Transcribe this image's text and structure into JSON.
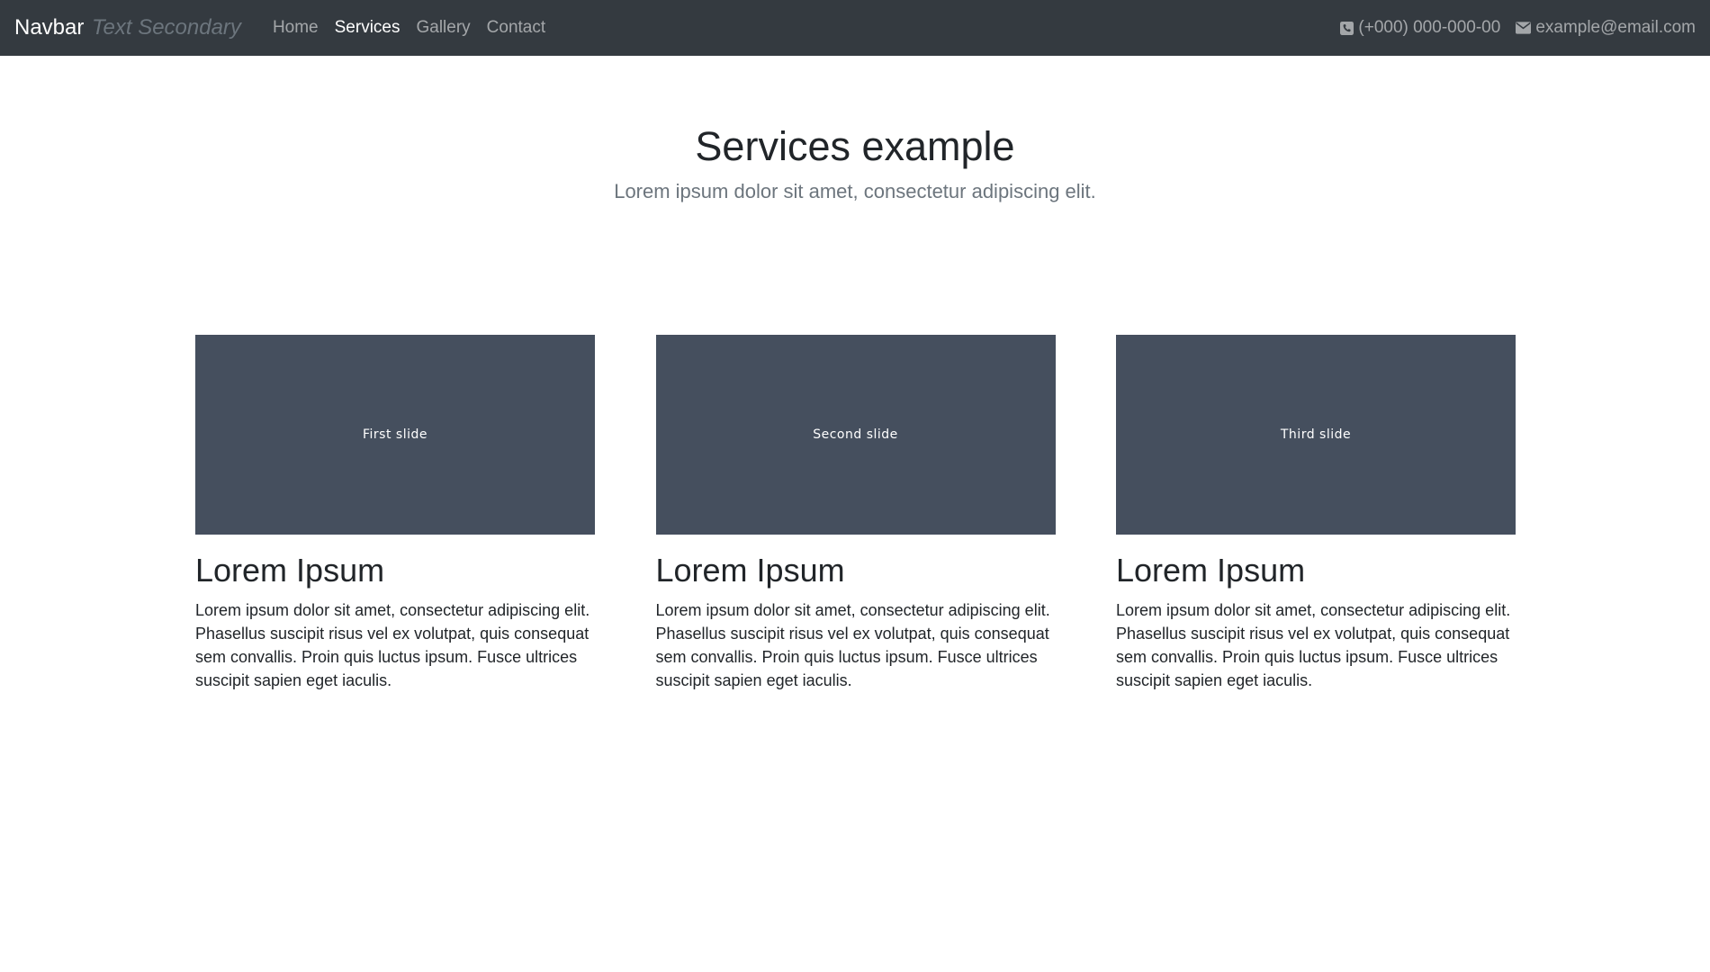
{
  "navbar": {
    "brand": "Navbar",
    "brand_secondary": "Text Secondary",
    "links": [
      {
        "label": "Home",
        "active": false
      },
      {
        "label": "Services",
        "active": true
      },
      {
        "label": "Gallery",
        "active": false
      },
      {
        "label": "Contact",
        "active": false
      }
    ],
    "phone": {
      "icon": "phone-square-icon",
      "text": "(+000) 000-000-00"
    },
    "email": {
      "icon": "envelope-icon",
      "text": "example@email.com"
    },
    "background_color": "#343a40"
  },
  "hero": {
    "title": "Services example",
    "lead": "Lorem ipsum dolor sit amet, consectetur adipiscing elit."
  },
  "cards": [
    {
      "slide_label": "First slide",
      "title": "Lorem Ipsum",
      "text": "Lorem ipsum dolor sit amet, consectetur adipiscing elit. Phasellus suscipit risus vel ex volutpat, quis consequat sem convallis. Proin quis luctus ipsum. Fusce ultrices suscipit sapien eget iaculis."
    },
    {
      "slide_label": "Second slide",
      "title": "Lorem Ipsum",
      "text": "Lorem ipsum dolor sit amet, consectetur adipiscing elit. Phasellus suscipit risus vel ex volutpat, quis consequat sem convallis. Proin quis luctus ipsum. Fusce ultrices suscipit sapien eget iaculis."
    },
    {
      "slide_label": "Third slide",
      "title": "Lorem Ipsum",
      "text": "Lorem ipsum dolor sit amet, consectetur adipiscing elit. Phasellus suscipit risus vel ex volutpat, quis consequat sem convallis. Proin quis luctus ipsum. Fusce ultrices suscipit sapien eget iaculis."
    }
  ],
  "slide_color": "#454f5e"
}
